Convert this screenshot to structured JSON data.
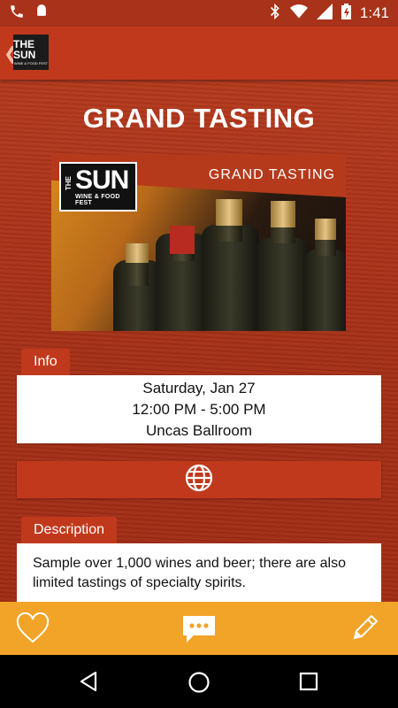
{
  "status_bar": {
    "time": "1:41",
    "icons": [
      "phone-icon",
      "android-icon",
      "bluetooth-icon",
      "wifi-icon",
      "signal-icon",
      "battery-icon"
    ]
  },
  "app_bar": {
    "back_icon": "chevron-left-icon",
    "logo": {
      "line1": "THE SUN",
      "line2": "WINE & FOOD FEST"
    }
  },
  "page": {
    "title": "GRAND TASTING"
  },
  "banner": {
    "label": "GRAND TASTING",
    "logo": {
      "the": "THE",
      "sun": "SUN",
      "sub": "WINE & FOOD FEST"
    }
  },
  "info": {
    "tab_label": "Info",
    "date": "Saturday, Jan 27",
    "time": "12:00 PM - 5:00 PM",
    "location": "Uncas Ballroom"
  },
  "website": {
    "icon": "globe-icon"
  },
  "description": {
    "tab_label": "Description",
    "text": "Sample over 1,000 wines and beer; there are also limited tastings of specialty spirits."
  },
  "action_bar": {
    "icons": [
      "heart-icon",
      "chat-icon",
      "pencil-icon"
    ]
  },
  "nav_bar": {
    "icons": [
      "back-triangle-icon",
      "home-circle-icon",
      "recents-square-icon"
    ]
  },
  "colors": {
    "primary": "#c1391c",
    "status_bar": "#a8321a",
    "accent": "#f1a428"
  }
}
